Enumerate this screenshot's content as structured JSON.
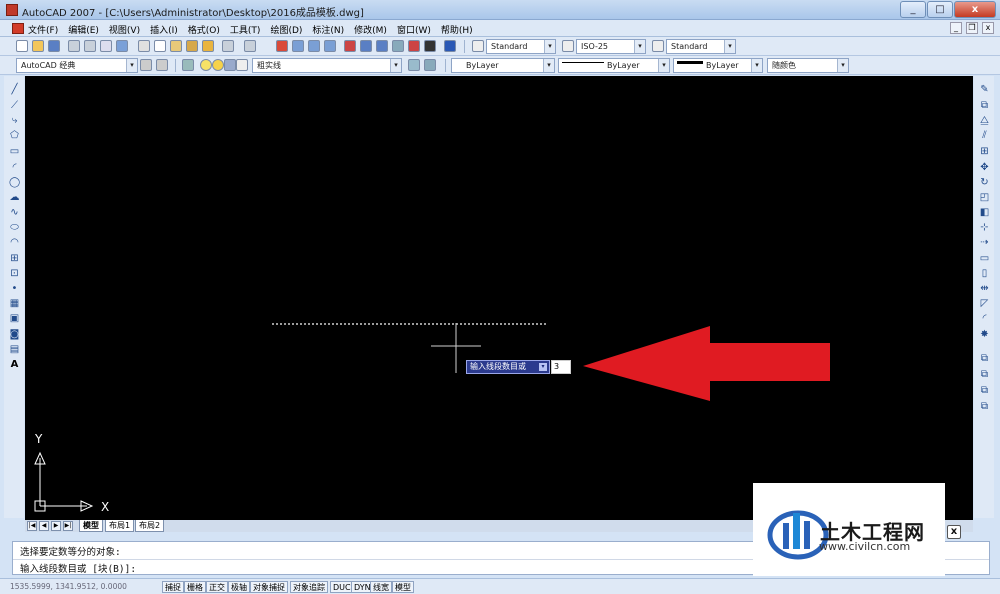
{
  "window": {
    "title": "AutoCAD 2007 - [C:\\Users\\Administrator\\Desktop\\2016成品模板.dwg]",
    "min_label": "_",
    "max_label": "□",
    "close_label": "x"
  },
  "menubar": {
    "items": [
      "文件(F)",
      "编辑(E)",
      "视图(V)",
      "插入(I)",
      "格式(O)",
      "工具(T)",
      "绘图(D)",
      "标注(N)",
      "修改(M)",
      "窗口(W)",
      "帮助(H)"
    ],
    "mdi_min": "_",
    "mdi_restore": "❐",
    "mdi_close": "x"
  },
  "toolbar1": {
    "text_style": "Standard",
    "dim_style": "ISO-25",
    "table_style": "Standard"
  },
  "toolbar2": {
    "workspace": "AutoCAD 经典",
    "layer": "粗实线",
    "color": "ByLayer",
    "linetype": "ByLayer",
    "lineweight": "ByLayer",
    "plot_style": "随颜色"
  },
  "canvas": {
    "prompt_label": "输入线段数目或",
    "input_value": "3",
    "dropdown_glyph": "▾",
    "axis_y": "Y",
    "axis_x": "X"
  },
  "tabs": {
    "items": [
      "模型",
      "布局1",
      "布局2"
    ],
    "nav": [
      "|◀",
      "◀",
      "▶",
      "▶|"
    ]
  },
  "command": {
    "line1": "选择要定数等分的对象:",
    "line2": "输入线段数目或 [块(B)]:"
  },
  "status": {
    "coords": "1535.5999, 1341.9512, 0.0000",
    "buttons": [
      "捕捉",
      "栅格",
      "正交",
      "极轴",
      "对象捕捉",
      "对象追踪",
      "DUCS",
      "DYN",
      "线宽",
      "模型"
    ]
  },
  "watermark": {
    "title": "土木工程网",
    "url": "www.civilcn.com",
    "close": "x"
  },
  "colors": {
    "canvas_bg": "#000000",
    "arrow": "#e01b22",
    "accent": "#2b3a8e"
  }
}
